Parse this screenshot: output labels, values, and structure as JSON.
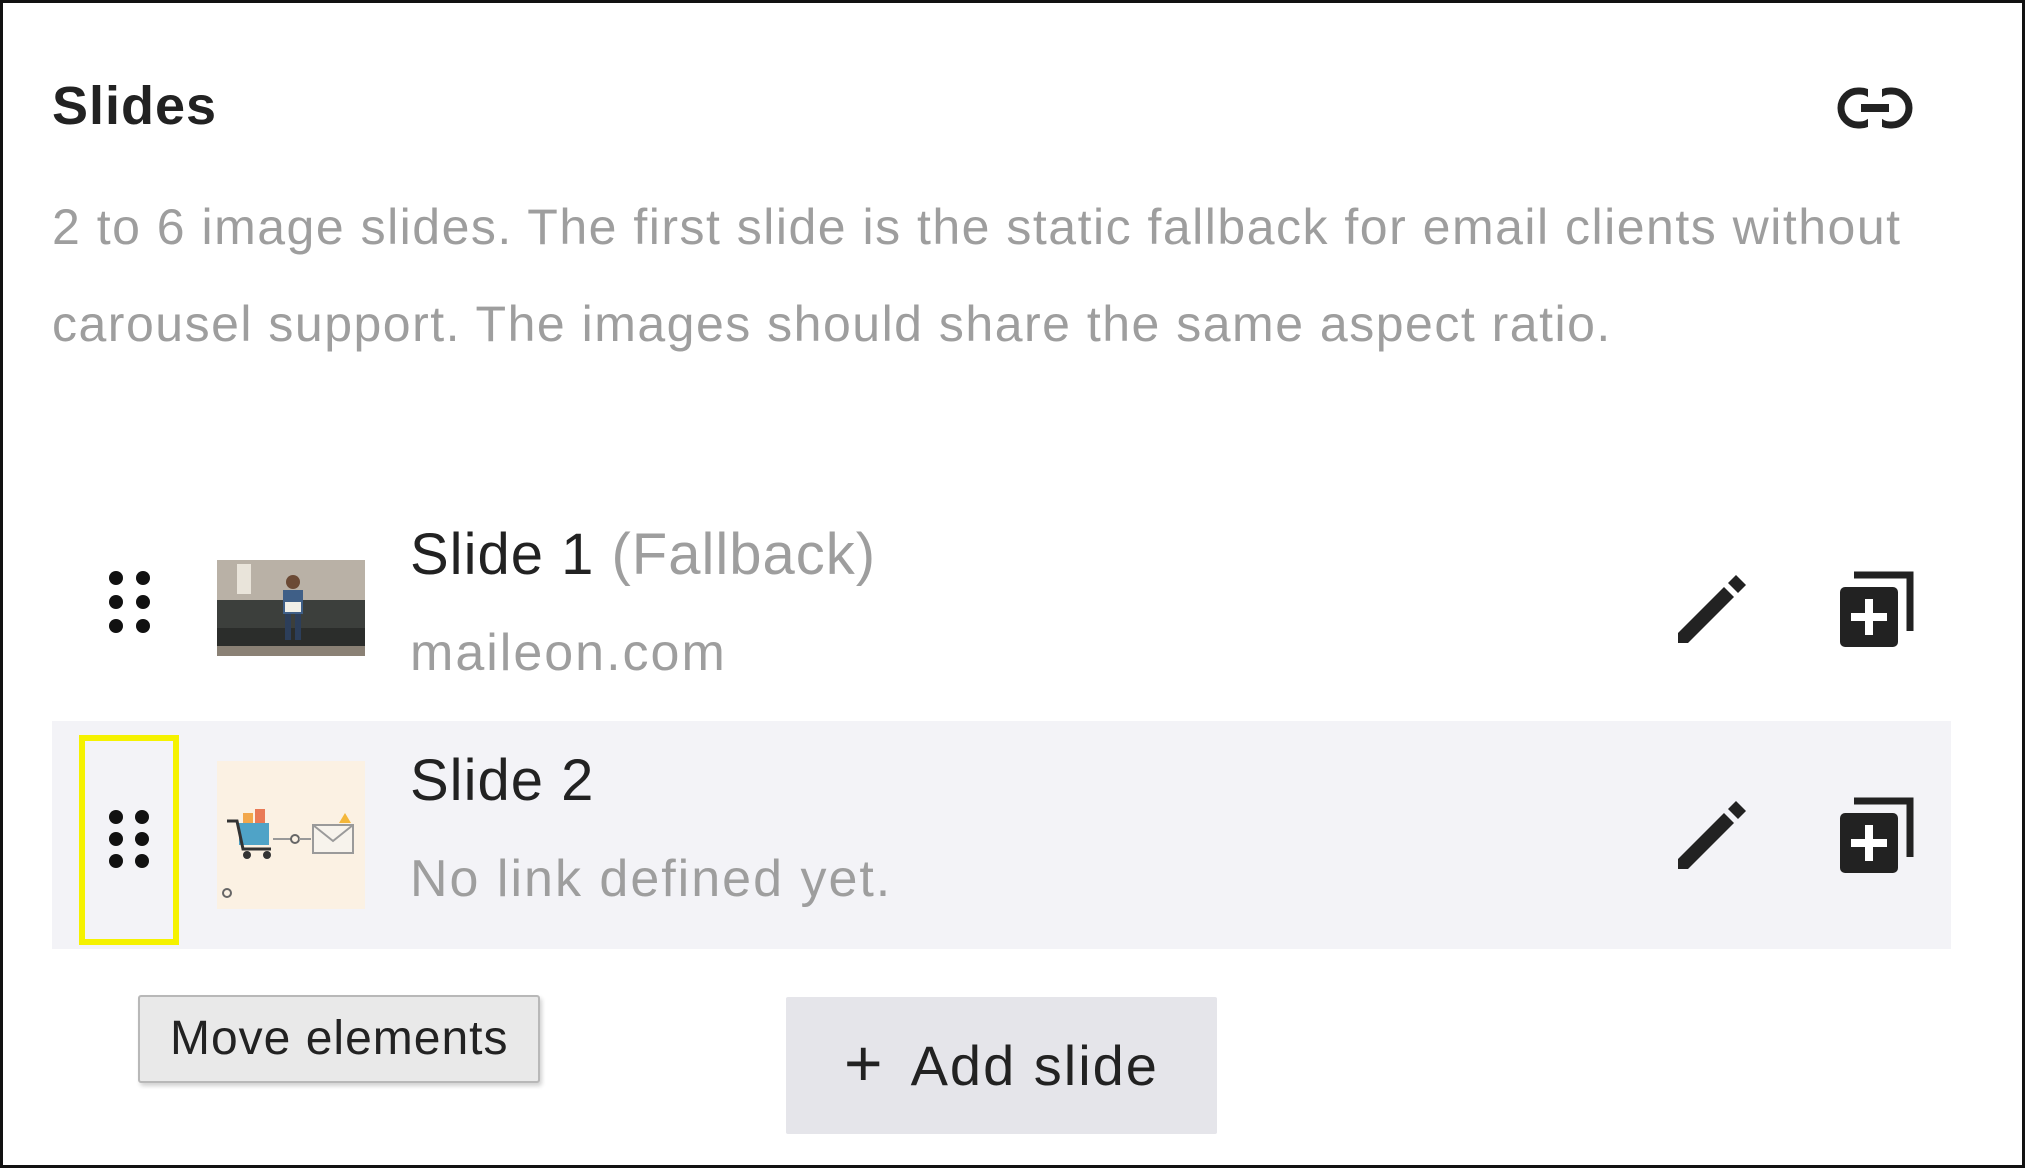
{
  "panel": {
    "title": "Slides",
    "description": "2 to 6 image slides. The first slide is the static fallback for email clients without carousel support. The images should share the same aspect ratio."
  },
  "icons": {
    "link": "link-icon",
    "drag": "drag-handle-icon",
    "edit": "pencil-icon",
    "duplicate": "duplicate-icon",
    "add": "plus-icon"
  },
  "slides": [
    {
      "title": "Slide 1",
      "title_suffix": "(Fallback)",
      "subtitle": "maileon.com",
      "thumbnail": "person-on-sofa-photo"
    },
    {
      "title": "Slide 2",
      "title_suffix": "",
      "subtitle": "No link defined yet.",
      "thumbnail": "shopping-cart-email-illustration",
      "selected": true
    }
  ],
  "tooltip": {
    "text": "Move elements"
  },
  "actions": {
    "add_slide_label": "Add slide"
  },
  "colors": {
    "muted_text": "#9e9e9e",
    "selected_row_bg": "#f3f3f7",
    "highlight_border": "#f5f200",
    "add_button_bg": "#e5e5ea"
  }
}
